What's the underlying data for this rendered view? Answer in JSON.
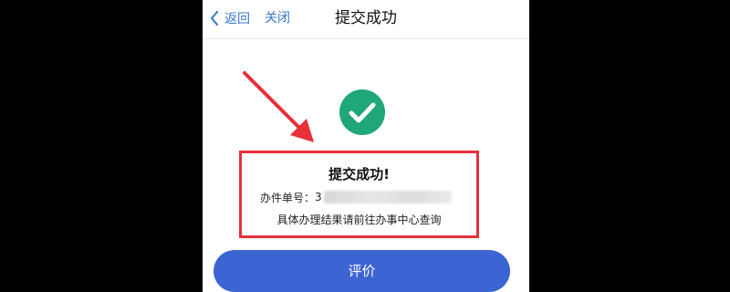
{
  "nav": {
    "back_label": "返回",
    "close_label": "关闭",
    "title": "提交成功"
  },
  "result": {
    "heading": "提交成功!",
    "order_label": "办件单号：",
    "order_visible_prefix": "3",
    "note": "具体办理结果请前往办事中心查询"
  },
  "actions": {
    "rate_label": "评价"
  },
  "colors": {
    "accent_blue": "#3478c8",
    "button_blue": "#3c64d2",
    "success_green": "#1fa67a",
    "highlight_red": "#e8303a"
  },
  "icons": {
    "back": "chevron-left-icon",
    "success": "check-circle-icon",
    "annotation": "red-arrow-icon"
  }
}
